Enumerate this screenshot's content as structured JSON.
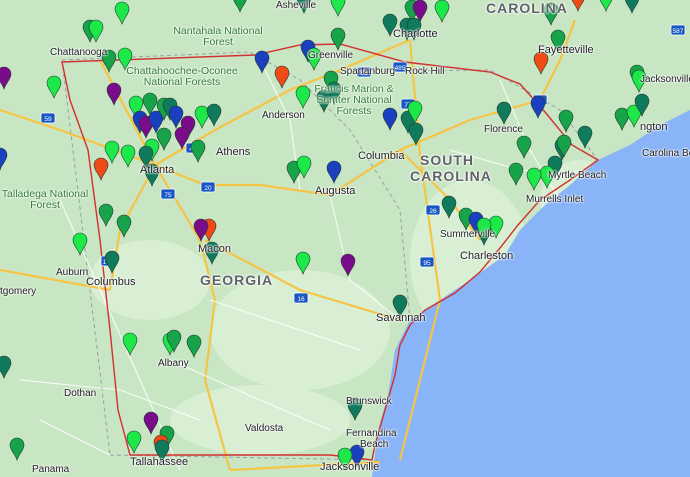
{
  "map": {
    "colors": {
      "land": "#c8e6c4",
      "land_light": "#d9efd3",
      "ocean": "#8ab4f8",
      "highway": "#f6c445",
      "road": "#ffffff",
      "boundary": "#d32f2f",
      "state_line": "#9aa0a6"
    },
    "pin_colors": {
      "light_green": "#1de84a",
      "green": "#16a34a",
      "teal": "#0f7a5c",
      "blue": "#1a3fbf",
      "teal_blue": "#0a6b8a",
      "orange": "#f04a17",
      "purple": "#7a0b8a"
    },
    "pin_icon": "map-marker-icon",
    "region_label": {
      "georgia": "GEORGIA",
      "south_carolina_1": "SOUTH",
      "south_carolina_2": "CAROLINA",
      "north_carolina": "CAROLINA"
    },
    "forests": {
      "nantahala": "Nantahala National Forest",
      "chattahoochee": "Chattahoochee-Oconee National Forests",
      "francis_marion": "Francis Marion & Sumter National Forests",
      "talladega": "Talladega National Forest"
    },
    "cities": {
      "chattanooga": "Chattanooga",
      "asheville": "Asheville",
      "charlotte": "Charlotte",
      "greenville": "Greenville",
      "spartanburg": "Spartanburg",
      "rock_hill": "Rock Hill",
      "anderson": "Anderson",
      "fayetteville": "Fayetteville",
      "jacksonville_nc": "Jacksonville",
      "wilmington": "ngton",
      "carolina_beach": "Carolina Be",
      "florence": "Florence",
      "myrtle_beach": "Myrtle Beach",
      "murrells_inlet": "Murrells Inlet",
      "columbia": "Columbia",
      "athens": "Athens",
      "atlanta": "Atlanta",
      "augusta": "Augusta",
      "summerville": "Summerville",
      "charleston": "Charleston",
      "macon": "Macon",
      "auburn": "Auburn",
      "montgomery": "tgomery",
      "columbus": "Columbus",
      "savannah": "Savannah",
      "albany": "Albany",
      "dothan": "Dothan",
      "brunswick": "Brunswick",
      "valdosta": "Valdosta",
      "fernandina": "Fernandina",
      "fernandina_2": "Beach",
      "tallahassee": "Tallahassee",
      "jacksonville_fl": "Jacksonville",
      "panama": "Panama"
    },
    "highway_shields": [
      "485",
      "85",
      "77",
      "26",
      "95",
      "74",
      "16",
      "75",
      "185",
      "20",
      "59",
      "40",
      "587"
    ]
  }
}
